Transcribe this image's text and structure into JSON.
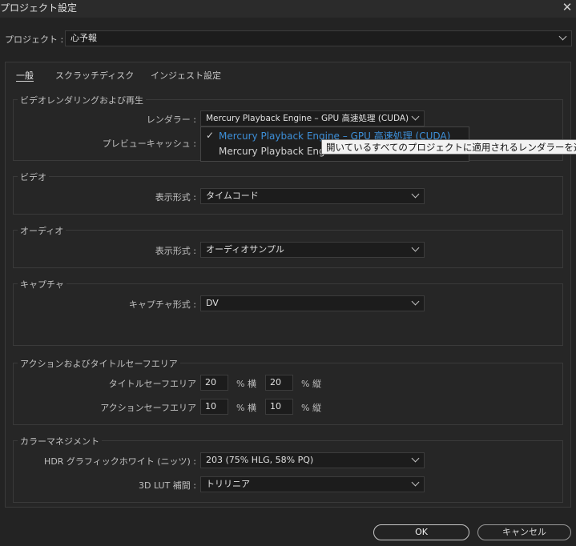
{
  "window": {
    "title": "プロジェクト設定",
    "close": "✕"
  },
  "project": {
    "label": "プロジェクト :",
    "value": "心予報"
  },
  "tabs": [
    {
      "label": "一般"
    },
    {
      "label": "スクラッチディスク"
    },
    {
      "label": "インジェスト設定"
    }
  ],
  "video_rendering": {
    "title": "ビデオレンダリングおよび再生",
    "renderer_label": "レンダラー :",
    "renderer_value": "Mercury Playback Engine – GPU 高速処理 (CUDA)",
    "preview_cache_label": "プレビューキャッシュ :",
    "menu": {
      "items": [
        {
          "label": "Mercury  Playback  Engine  –  GPU  高速処理  (CUDA)",
          "selected": true
        },
        {
          "label": "Mercury  Playback  Eng"
        }
      ],
      "tooltip": "開いているすべてのプロジェクトに適用されるレンダラーを選択"
    }
  },
  "video": {
    "title": "ビデオ",
    "format_label": "表示形式 :",
    "format_value": "タイムコード"
  },
  "audio": {
    "title": "オーディオ",
    "format_label": "表示形式 :",
    "format_value": "オーディオサンプル"
  },
  "capture": {
    "title": "キャプチャ",
    "format_label": "キャプチャ形式 :",
    "format_value": "DV"
  },
  "safe_area": {
    "title": "アクションおよびタイトルセーフエリア",
    "title_safe_label": "タイトルセーフエリア",
    "title_safe_h": "20",
    "title_safe_v": "20",
    "action_safe_label": "アクションセーフエリア",
    "action_safe_h": "10",
    "action_safe_v": "10",
    "unit_h": "% 横",
    "unit_v": "% 縦"
  },
  "color_management": {
    "title": "カラーマネジメント",
    "hdr_label": "HDR グラフィックホワイト (ニッツ) :",
    "hdr_value": "203 (75% HLG, 58% PQ)",
    "lut_label": "3D LUT 補間 :",
    "lut_value": "トリリニア"
  },
  "buttons": {
    "ok": "OK",
    "cancel": "キャンセル"
  },
  "colors": {
    "background": "#232323",
    "accent": "#3d8fd8",
    "tooltip_bg": "#f2f2f2"
  }
}
